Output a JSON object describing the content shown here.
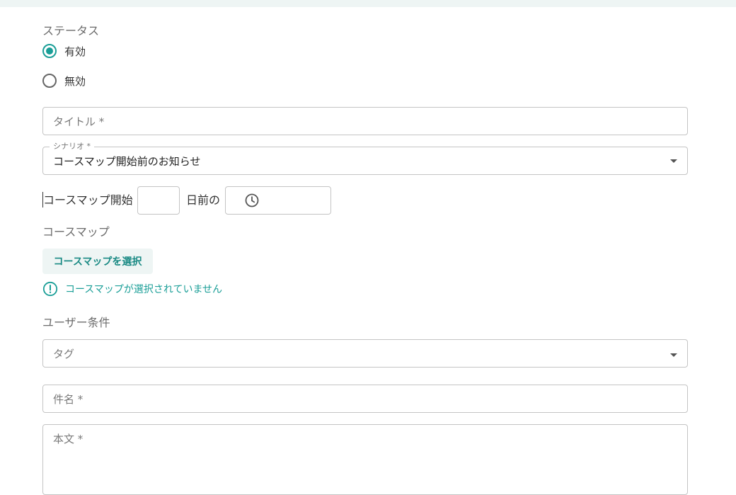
{
  "status": {
    "label": "ステータス",
    "options": [
      {
        "label": "有効",
        "selected": true
      },
      {
        "label": "無効",
        "selected": false
      }
    ]
  },
  "title_field": {
    "placeholder": "タイトル *"
  },
  "scenario_field": {
    "label": "シナリオ *",
    "value": "コースマップ開始前のお知らせ"
  },
  "schedule": {
    "prefix": "コースマップ開始",
    "days_value": "",
    "middle": "日前の",
    "time_value": ""
  },
  "coursemap": {
    "label": "コースマップ",
    "select_button": "コースマップを選択",
    "warning": "コースマップが選択されていません"
  },
  "user_conditions": {
    "label": "ユーザー条件",
    "tag_placeholder": "タグ"
  },
  "subject_field": {
    "placeholder": "件名 *"
  },
  "body_field": {
    "placeholder": "本文 *"
  },
  "colors": {
    "accent": "#1a9e97",
    "accent_bg": "#eef5f4",
    "border": "#c4c4c4"
  },
  "icons": {
    "time": "clock-icon",
    "warning": "exclamation-circle-icon",
    "dropdown": "caret-down-icon"
  }
}
